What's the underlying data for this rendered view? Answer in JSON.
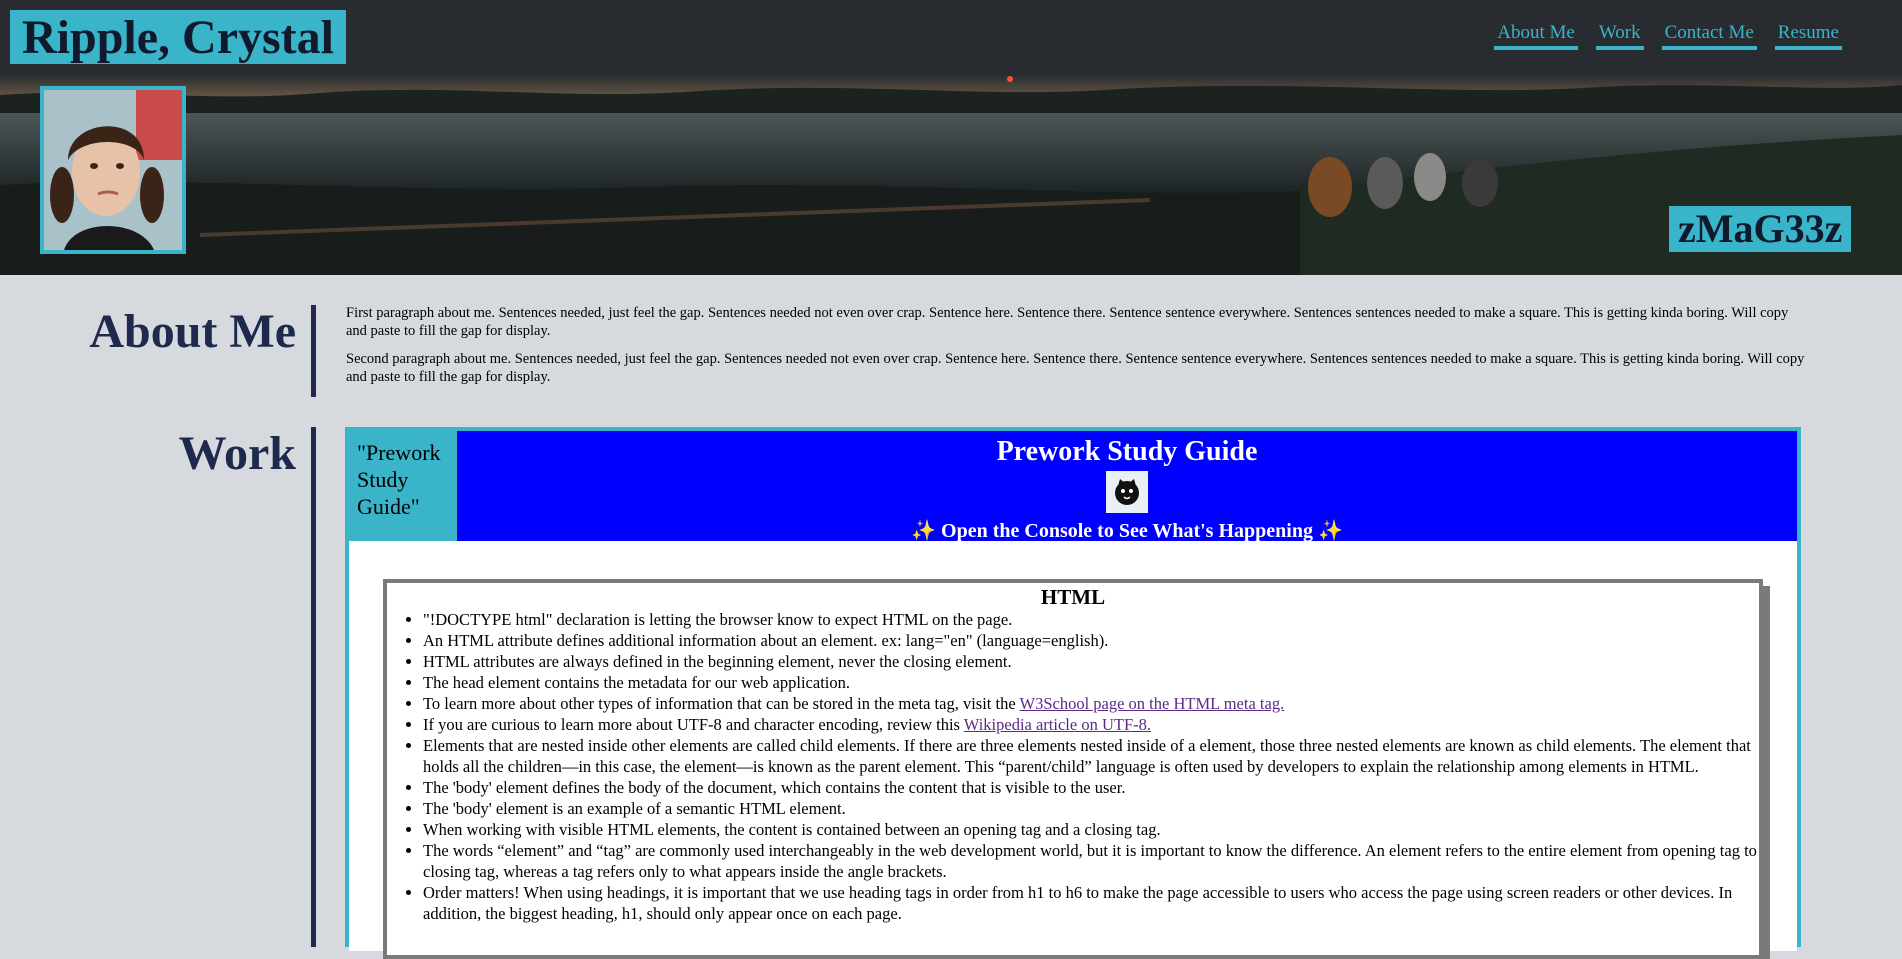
{
  "header": {
    "brand": "Ripple, Crystal",
    "nav": [
      "About Me",
      "Work",
      "Contact Me",
      "Resume"
    ]
  },
  "hero": {
    "tagline": "zMaG33z"
  },
  "about": {
    "title": "About Me",
    "paragraphs": [
      "First paragraph about me. Sentences needed, just feel the gap. Sentences needed not even over crap. Sentence here. Sentence there. Sentence sentence everywhere. Sentences sentences needed to make a square. This is getting kinda boring. Will copy and paste to fill the gap for display.",
      "Second paragraph about me. Sentences needed, just feel the gap. Sentences needed not even over crap. Sentence here. Sentence there. Sentence sentence everywhere. Sentences sentences needed to make a square. This is getting kinda boring. Will copy and paste to fill the gap for display."
    ]
  },
  "work": {
    "title": "Work",
    "card_alt": "\"Prework Study Guide\"",
    "banner_title": "Prework Study Guide",
    "console_line": "✨ Open the Console to See What's Happening ✨",
    "guide_heading": "HTML",
    "items": [
      "\"!DOCTYPE html\" declaration is letting the browser know to expect HTML on the page.",
      "An HTML attribute defines additional information about an element. ex: lang=\"en\" (language=english).",
      "HTML attributes are always defined in the beginning element, never the closing element.",
      "The head element contains the metadata for our web application.",
      "To learn more about other types of information that can be stored in the meta tag, visit the ",
      "If you are curious to learn more about UTF-8 and character encoding, review this ",
      "Elements that are nested inside other elements are called child elements. If there are three elements nested inside of a element, those three nested elements are known as child elements. The element that holds all the children—in this case, the element—is known as the parent element. This “parent/child” language is often used by developers to explain the relationship among elements in HTML.",
      "The 'body' element defines the body of the document, which contains the content that is visible to the user.",
      "The 'body' element is an example of a semantic HTML element.",
      "When working with visible HTML elements, the content is contained between an opening tag and a closing tag.",
      "The words “element” and “tag” are commonly used interchangeably in the web development world, but it is important to know the difference. An element refers to the entire element from opening tag to closing tag, whereas a tag refers only to what appears inside the angle brackets.",
      "Order matters! When using headings, it is important that we use heading tags in order from h1 to h6 to make the page accessible to users who access the page using screen readers or other devices. In addition, the biggest heading, h1, should only appear once on each page."
    ],
    "links": {
      "meta": "W3School page on the HTML meta tag.",
      "utf8": "Wikipedia article on UTF-8."
    }
  },
  "colors": {
    "accent": "#3ab4c8",
    "header_bg": "#282c30",
    "page_bg": "#d6d9de",
    "heading": "#1e2a4c",
    "banner": "#0000ff"
  }
}
